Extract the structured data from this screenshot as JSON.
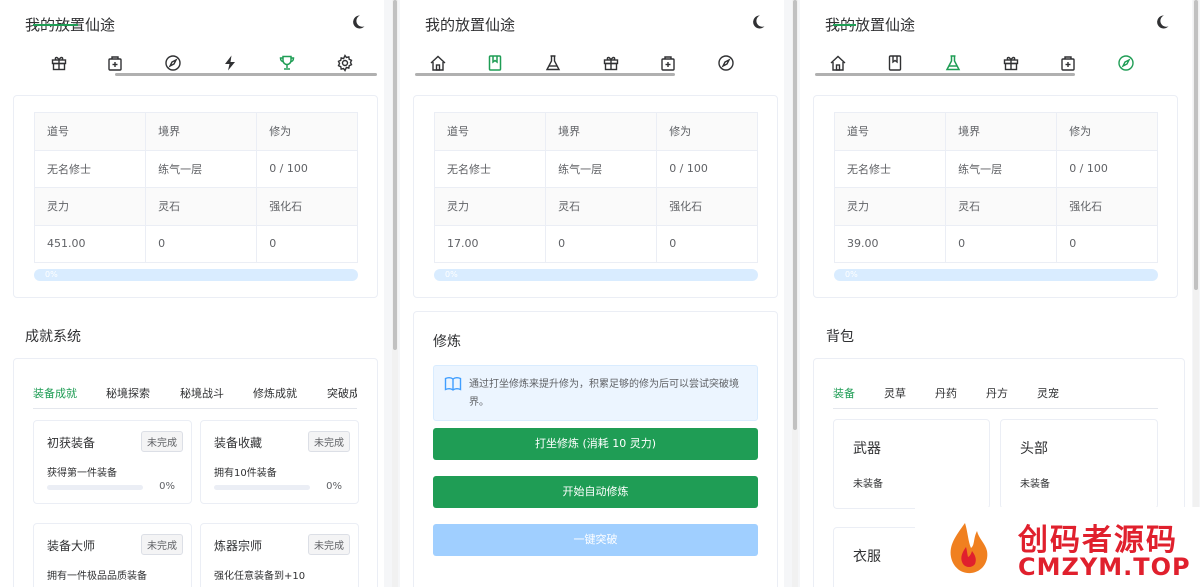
{
  "app_title": "我的放置仙途",
  "columns": [
    {
      "nav_icons": [
        "gift-icon",
        "bag-icon",
        "compass-icon",
        "bolt-icon",
        "trophy-icon",
        "gear-icon"
      ],
      "active_nav": "trophy-icon",
      "stats": {
        "headers1": [
          "道号",
          "境界",
          "修为"
        ],
        "values1": [
          "无名修士",
          "练气一层",
          "0 / 100"
        ],
        "headers2": [
          "灵力",
          "灵石",
          "强化石"
        ],
        "values2": [
          "451.00",
          "0",
          "0"
        ],
        "progress": "0%"
      },
      "section_title": "成就系统",
      "tabs": [
        "装备成就",
        "秘境探索",
        "秘境战斗",
        "修炼成就",
        "突破成"
      ],
      "achievements": [
        {
          "name": "初获装备",
          "status": "未完成",
          "desc": "获得第一件装备",
          "pct": "0%"
        },
        {
          "name": "装备收藏",
          "status": "未完成",
          "desc": "拥有10件装备",
          "pct": "0%"
        },
        {
          "name": "装备大师",
          "status": "未完成",
          "desc": "拥有一件极品品质装备",
          "pct": ""
        },
        {
          "name": "炼器宗师",
          "status": "未完成",
          "desc": "强化任意装备到+10",
          "pct": ""
        }
      ]
    },
    {
      "nav_icons": [
        "home-icon",
        "book-icon",
        "flask-icon",
        "gift-icon",
        "bag-icon",
        "compass-icon"
      ],
      "active_nav": "book-icon",
      "stats": {
        "headers1": [
          "道号",
          "境界",
          "修为"
        ],
        "values1": [
          "无名修士",
          "练气一层",
          "0 / 100"
        ],
        "headers2": [
          "灵力",
          "灵石",
          "强化石"
        ],
        "values2": [
          "17.00",
          "0",
          "0"
        ],
        "progress": "0%"
      },
      "section_title": "修炼",
      "notice": "通过打坐修炼来提升修为，积累足够的修为后可以尝试突破境界。",
      "buttons": [
        "打坐修炼 (消耗 10 灵力)",
        "开始自动修炼",
        "一键突破"
      ]
    },
    {
      "nav_icons": [
        "home-icon",
        "book-icon",
        "flask-icon",
        "gift-icon",
        "bag-icon",
        "compass-icon"
      ],
      "active_nav": "flask-icon",
      "stats": {
        "headers1": [
          "道号",
          "境界",
          "修为"
        ],
        "values1": [
          "无名修士",
          "练气一层",
          "0 / 100"
        ],
        "headers2": [
          "灵力",
          "灵石",
          "强化石"
        ],
        "values2": [
          "39.00",
          "0",
          "0"
        ],
        "progress": "0%"
      },
      "section_title": "背包",
      "tabs": [
        "装备",
        "灵草",
        "丹药",
        "丹方",
        "灵宠"
      ],
      "equipment": [
        {
          "name": "武器",
          "state": "未装备"
        },
        {
          "name": "头部",
          "state": "未装备"
        },
        {
          "name": "衣服",
          "state": ""
        }
      ]
    }
  ],
  "watermark": {
    "cn": "创码者源码",
    "en": "CMZYM.TOP"
  },
  "colors": {
    "primary": "#1f9d55",
    "progress_bg": "#d9ecff",
    "disabled_btn": "#a0cfff"
  }
}
